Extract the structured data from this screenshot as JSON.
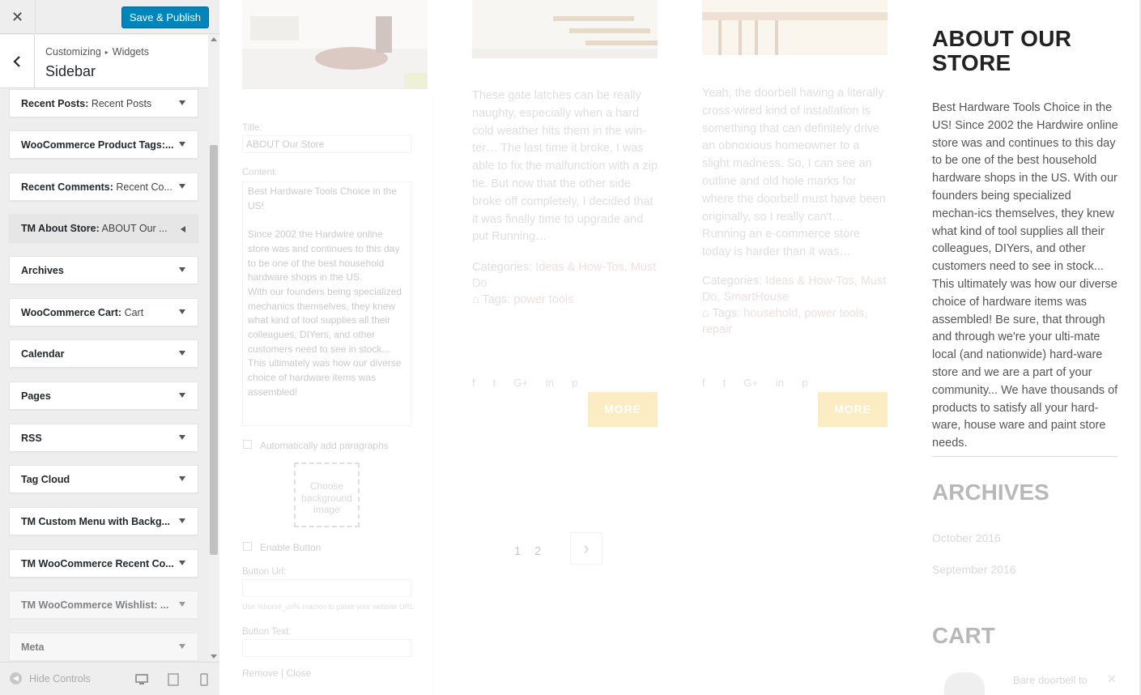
{
  "topbar": {
    "close_label": "✕",
    "publish_label": "Save & Publish"
  },
  "section": {
    "crumb_1": "Customizing",
    "crumb_arrow": "▸",
    "crumb_2": "Widgets",
    "title": "Sidebar"
  },
  "widgets": [
    {
      "name": "Recent Posts:",
      "sub": " Recent Posts"
    },
    {
      "name": "WooCommerce Product Tags:...",
      "sub": ""
    },
    {
      "name": "Recent Comments:",
      "sub": " Recent Co..."
    },
    {
      "name": "TM About Store:",
      "sub": " ABOUT Our ..."
    },
    {
      "name": "Archives",
      "sub": ""
    },
    {
      "name": "WooCommerce Cart:",
      "sub": " Cart"
    },
    {
      "name": "Calendar",
      "sub": ""
    },
    {
      "name": "Pages",
      "sub": ""
    },
    {
      "name": "RSS",
      "sub": ""
    },
    {
      "name": "Tag Cloud",
      "sub": ""
    },
    {
      "name": "TM Custom Menu with Backg...",
      "sub": ""
    },
    {
      "name": "TM WooCommerce Recent Co...",
      "sub": ""
    },
    {
      "name": "TM WooCommerce Wishlist: ...",
      "sub": ""
    },
    {
      "name": "Meta",
      "sub": ""
    }
  ],
  "footer": {
    "hide_controls": "Hide Controls"
  },
  "form": {
    "title_label": "Title:",
    "title_value": "ABOUT Our Store",
    "content_label": "Content:",
    "content_value": "Best Hardware Tools Choice in the US!\n\nSince 2002 the Hardwire online store was and continues to this day to be one of the best household hardware shops in the US.\nWith our founders being specialized mechanics themselves, they knew what kind of tool supplies all their colleagues, DIYers, and other customers need to see in stock... This ultimately was how our diverse choice of hardware items was assembled!",
    "auto_paragraphs": "Automatically add paragraphs",
    "choose_bg": "Choose background image",
    "enable_button": "Enable Button",
    "button_url_label": "Button Url:",
    "button_url_hint": "Use %home_url% macros to paste your website URL",
    "button_text_label": "Button Text:",
    "remove": "Remove",
    "sep": " | ",
    "close": "Close"
  },
  "posts": [
    {
      "excerpt": "These gate latches can be really naughty, especially when a hard cold weather hits them in the win-ter… The last time it broke, I was able to fix the malfunction with a zip tie. But now that the other side broke off completely, I decided that it was finally time to upgrade and put Running…",
      "categories_label": "Categories:",
      "categories": "Ideas & How-Tos, Must Do",
      "tags_label": "Tags:",
      "tags": "power tools",
      "more": "MORE"
    },
    {
      "excerpt": "Yeah, the doorbell having a literally cross-wired kind of installation is something that can definitely drive an obnoxious homeowner to a slight madness. So, I can see an outline and old hole marks for where the doorbell must have been originally, so I really can't… Running an e-commerce store today is harder than it was…",
      "categories_label": "Categories:",
      "categories": "Ideas & How-Tos, Must Do, SmartHouse",
      "tags_label": "Tags:",
      "tags": "household, power tools, repair",
      "more": "MORE"
    }
  ],
  "social_icons": [
    "f",
    "t",
    "G+",
    "in",
    "p"
  ],
  "pager": {
    "page_1": "1",
    "page_2": "2",
    "next": "›"
  },
  "sidebar": {
    "about_title": "ABOUT OUR STORE",
    "about_text": "Best Hardware Tools Choice in the US! Since 2002 the Hardwire online store was and continues to this day to be one of the best household hardware shops in the US. With our founders being specialized mechan-ics themselves, they knew what kind of tool supplies all their colleagues, DIYers, and other customers need to see in stock... This ultimately was how our diverse choice of hardware items was assembled! Be sure, that through and through we're your ulti-mate local (and nationwide) hard-ware store and we are a part of your community... We have thousands of products to satisfy all your hard-ware, house ware and paint store needs.",
    "archives_title": "ARCHIVES",
    "archive_1": "October 2016",
    "archive_2": "September 2016",
    "cart_title": "CART",
    "cart_item": "Bare doorbell to"
  },
  "colors": {
    "accent": "#0085ba",
    "more_button": "#f5c242",
    "panel_bg": "#eeeeee"
  }
}
